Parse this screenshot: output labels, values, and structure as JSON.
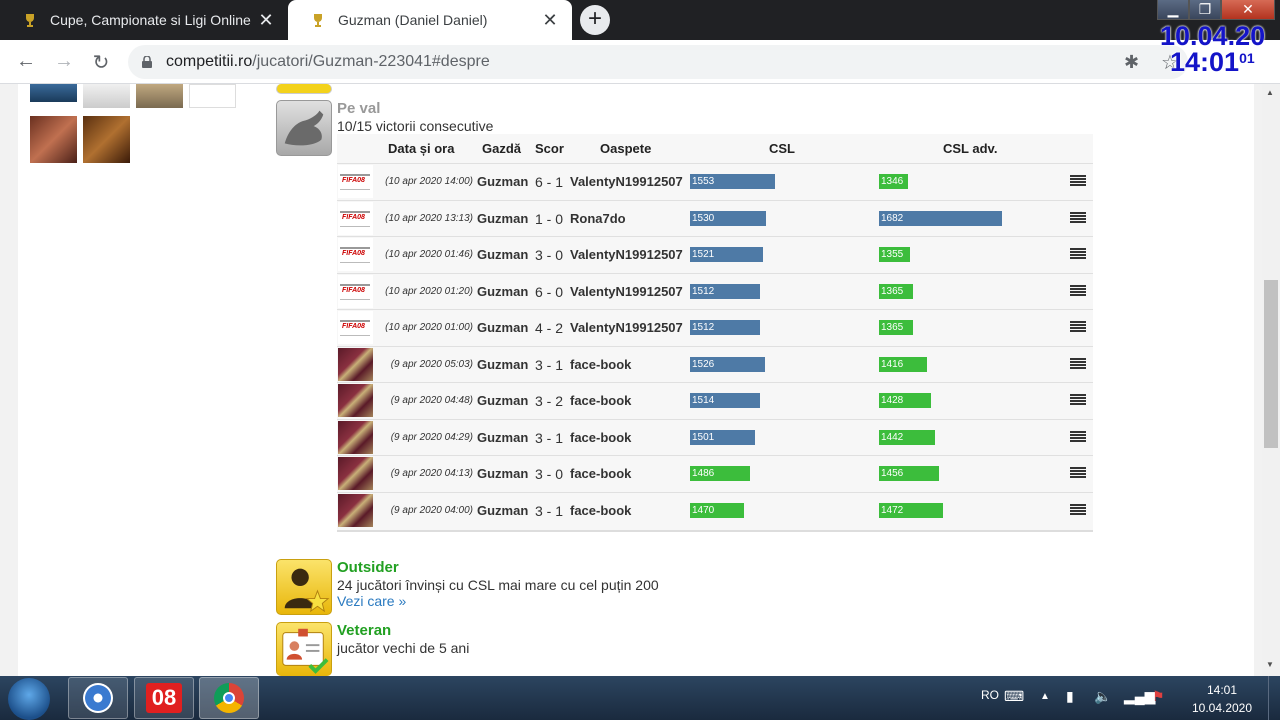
{
  "browser": {
    "tabs": [
      {
        "label": "Cupe, Campionate si Ligi Online",
        "close": "✕"
      },
      {
        "label": "Guzman (Daniel Daniel)",
        "close": "✕"
      }
    ],
    "new_tab": "+",
    "url_domain": "competitii.ro",
    "url_path": "/jucatori/Guzman-223041#despre"
  },
  "clock_overlay": {
    "date": "10.04.20",
    "time": "14:01",
    "seconds": "01"
  },
  "achievements": {
    "streak": {
      "title": "Pe val",
      "description": "10/15 victorii consecutive"
    },
    "outsider": {
      "title": "Outsider",
      "description": "24 jucători învinși cu CSL mai mare cu cel puțin 200",
      "link": "Vezi care »"
    },
    "veteran": {
      "title": "Veteran",
      "description": "jucător vechi de 5 ani"
    }
  },
  "table": {
    "headers": {
      "date": "Data și ora",
      "home": "Gazdă",
      "score": "Scor",
      "away": "Oaspete",
      "csl": "CSL",
      "csl_adv": "CSL adv."
    },
    "rows": [
      {
        "game": "fifa",
        "game_label": "FIFA08",
        "date": "(10 apr 2020 14:00)",
        "home": "Guzman",
        "score": "6 - 1",
        "away": "ValentyN19912507",
        "csl": 1553,
        "csl_adv": 1346,
        "csl_color": "blue",
        "adv_color": "green"
      },
      {
        "game": "fifa",
        "game_label": "FIFA08",
        "date": "(10 apr 2020 13:13)",
        "home": "Guzman",
        "score": "1 - 0",
        "away": "Rona7do",
        "csl": 1530,
        "csl_adv": 1682,
        "csl_color": "blue",
        "adv_color": "blue"
      },
      {
        "game": "fifa",
        "game_label": "FIFA08",
        "date": "(10 apr 2020 01:46)",
        "home": "Guzman",
        "score": "3 - 0",
        "away": "ValentyN19912507",
        "csl": 1521,
        "csl_adv": 1355,
        "csl_color": "blue",
        "adv_color": "green"
      },
      {
        "game": "fifa",
        "game_label": "FIFA08",
        "date": "(10 apr 2020 01:20)",
        "home": "Guzman",
        "score": "6 - 0",
        "away": "ValentyN19912507",
        "csl": 1512,
        "csl_adv": 1365,
        "csl_color": "blue",
        "adv_color": "green"
      },
      {
        "game": "fifa",
        "game_label": "FIFA08",
        "date": "(10 apr 2020 01:00)",
        "home": "Guzman",
        "score": "4 - 2",
        "away": "ValentyN19912507",
        "csl": 1512,
        "csl_adv": 1365,
        "csl_color": "blue",
        "adv_color": "green"
      },
      {
        "game": "card",
        "game_label": "",
        "date": "(9 apr 2020 05:03)",
        "home": "Guzman",
        "score": "3 - 1",
        "away": "face-book",
        "csl": 1526,
        "csl_adv": 1416,
        "csl_color": "blue",
        "adv_color": "green"
      },
      {
        "game": "card",
        "game_label": "",
        "date": "(9 apr 2020 04:48)",
        "home": "Guzman",
        "score": "3 - 2",
        "away": "face-book",
        "csl": 1514,
        "csl_adv": 1428,
        "csl_color": "blue",
        "adv_color": "green"
      },
      {
        "game": "card",
        "game_label": "",
        "date": "(9 apr 2020 04:29)",
        "home": "Guzman",
        "score": "3 - 1",
        "away": "face-book",
        "csl": 1501,
        "csl_adv": 1442,
        "csl_color": "blue",
        "adv_color": "green"
      },
      {
        "game": "card",
        "game_label": "",
        "date": "(9 apr 2020 04:13)",
        "home": "Guzman",
        "score": "3 - 0",
        "away": "face-book",
        "csl": 1486,
        "csl_adv": 1456,
        "csl_color": "green",
        "adv_color": "green"
      },
      {
        "game": "card",
        "game_label": "",
        "date": "(9 apr 2020 04:00)",
        "home": "Guzman",
        "score": "3 - 1",
        "away": "face-book",
        "csl": 1470,
        "csl_adv": 1472,
        "csl_color": "green",
        "adv_color": "green"
      }
    ]
  },
  "colors": {
    "blue_bar": "#4e7aa6",
    "green_bar": "#3cbd3c",
    "achievement_green": "#22a022"
  },
  "taskbar": {
    "items": [
      {
        "name": "media-app-icon"
      },
      {
        "name": "game-08-icon",
        "label": "08"
      },
      {
        "name": "chrome-icon"
      }
    ],
    "language": "RO",
    "time": "14:01",
    "date": "10.04.2020"
  }
}
